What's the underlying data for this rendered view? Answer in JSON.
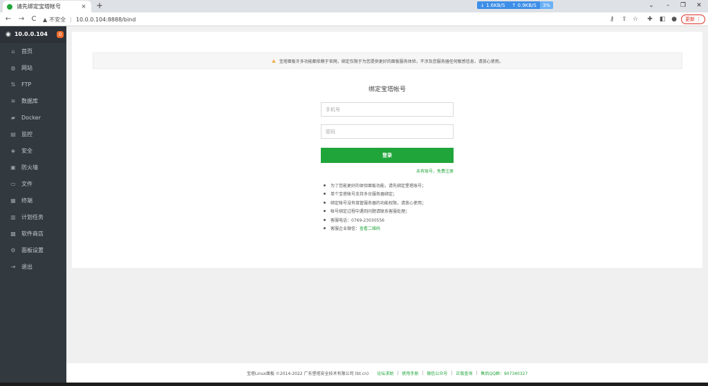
{
  "browser": {
    "tab_title": "请先绑定宝塔帐号",
    "tab_close": "×",
    "new_tab": "+",
    "net": {
      "down": "1.6KB/S",
      "up": "0.9KB/S",
      "percent": "3%"
    },
    "window": {
      "chevron": "⌄",
      "minimize": "–",
      "restore": "❐",
      "close": "✕"
    },
    "nav": {
      "back": "←",
      "forward": "→",
      "reload": "C"
    },
    "insecure_label": "不安全",
    "url": "10.0.0.104:8888/bind",
    "update_label": "更新"
  },
  "sidebar": {
    "host": "10.0.0.104",
    "badge": "0",
    "items": [
      {
        "label": "首页",
        "icon": "home-icon",
        "glyph": "⌂"
      },
      {
        "label": "网站",
        "icon": "globe-icon",
        "glyph": "◍"
      },
      {
        "label": "FTP",
        "icon": "ftp-icon",
        "glyph": "⇅"
      },
      {
        "label": "数据库",
        "icon": "database-icon",
        "glyph": "≋"
      },
      {
        "label": "Docker",
        "icon": "docker-icon",
        "glyph": "▰"
      },
      {
        "label": "监控",
        "icon": "monitor-icon",
        "glyph": "▤"
      },
      {
        "label": "安全",
        "icon": "shield-icon",
        "glyph": "◈"
      },
      {
        "label": "防火墙",
        "icon": "firewall-icon",
        "glyph": "▣"
      },
      {
        "label": "文件",
        "icon": "folder-icon",
        "glyph": "▭"
      },
      {
        "label": "终端",
        "icon": "terminal-icon",
        "glyph": "▦"
      },
      {
        "label": "计划任务",
        "icon": "calendar-icon",
        "glyph": "▥"
      },
      {
        "label": "软件商店",
        "icon": "grid-icon",
        "glyph": "▩"
      },
      {
        "label": "面板设置",
        "icon": "gear-icon",
        "glyph": "⚙"
      },
      {
        "label": "退出",
        "icon": "logout-icon",
        "glyph": "⇥"
      }
    ]
  },
  "main": {
    "notice": "宝塔面板许多功能都依赖于官网，绑定仅限于为您提供更好的面板服务体验，不涉及您服务器任何敏感信息，请放心使用。",
    "title": "绑定宝塔帐号",
    "phone_placeholder": "手机号",
    "password_placeholder": "密码",
    "login_label": "登录",
    "register_link": "未有账号，免费注册",
    "tips": [
      "为了您能更好的体验面板功能，请先绑定堡塔账号；",
      "单个宝塔帐号支持多台服务器绑定；",
      "绑定帐号没有接管服务器的功能权限，请放心使用；",
      "帐号绑定过程中遇到问题请联系客服处理；",
      "客服电话：0769-23030556",
      "客服企业微信："
    ],
    "tips_link": "查看二维码"
  },
  "footer": {
    "copyright": "宝塔Linux面板 ©2014-2022 广东堡塔安全技术有限公司 (bt.cn)",
    "links": [
      "论坛求助",
      "使用手册",
      "微信公众号",
      "正版查询"
    ],
    "qq": "售后QQ群：907340327",
    "separator": "|"
  },
  "colors": {
    "accent": "#20a53a",
    "sidebar_bg": "#32393f",
    "badge": "#f0692a",
    "warning": "#f0ad4e"
  }
}
